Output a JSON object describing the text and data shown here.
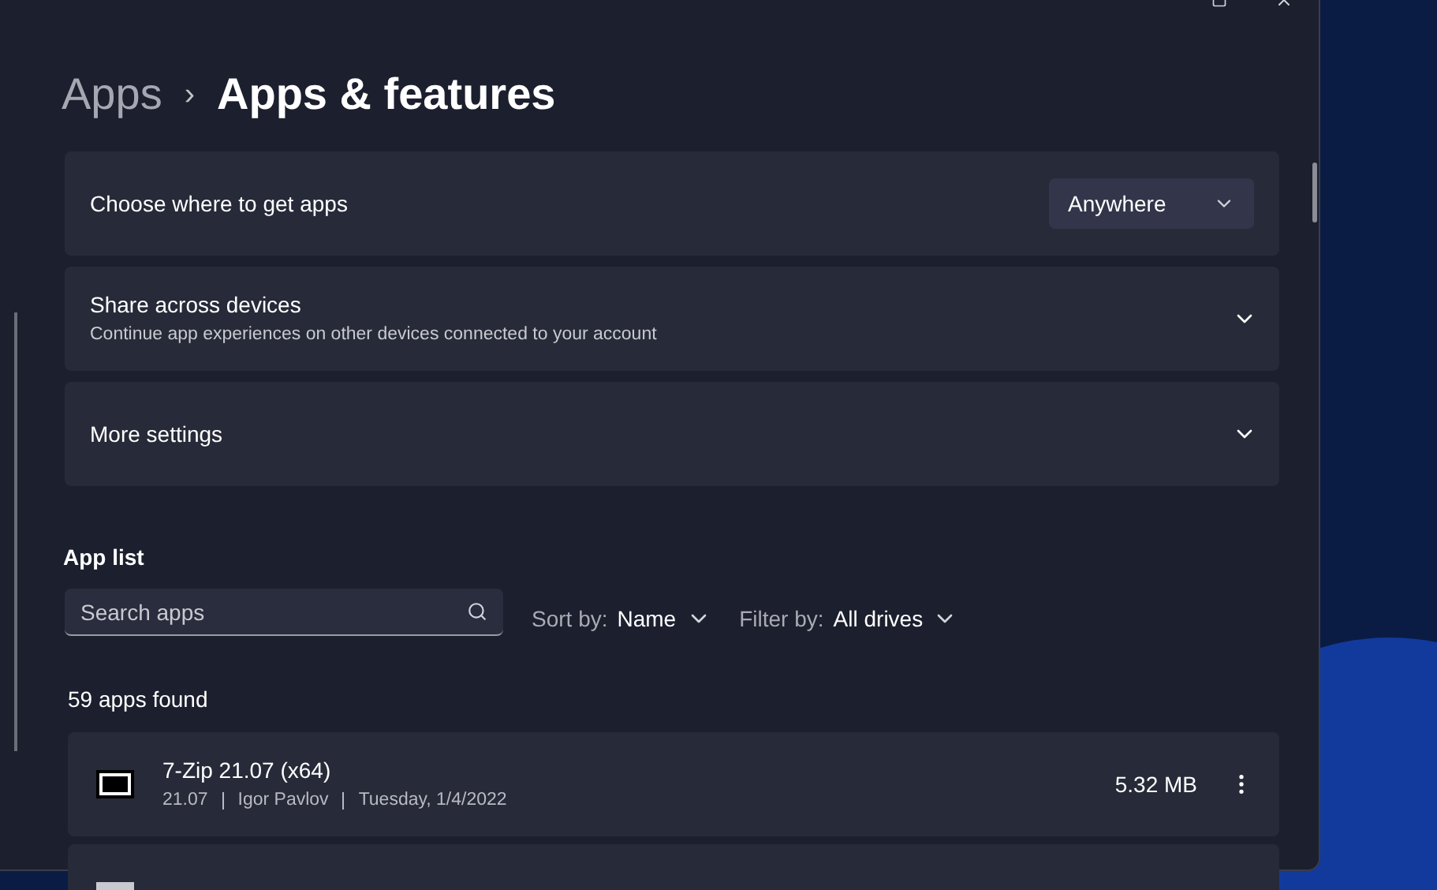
{
  "breadcrumb": {
    "parent": "Apps",
    "separator": "›",
    "current": "Apps & features"
  },
  "settings": [
    {
      "kind": "dropdown",
      "title": "Choose where to get apps",
      "value": "Anywhere"
    },
    {
      "kind": "expander",
      "title": "Share across devices",
      "subtitle": "Continue app experiences on other devices connected to your account",
      "expanded": false
    },
    {
      "kind": "expander",
      "title": "More settings",
      "expanded": false
    }
  ],
  "app_list": {
    "heading": "App list",
    "search": {
      "placeholder": "Search apps"
    },
    "sort": {
      "label": "Sort by:",
      "value": "Name"
    },
    "filter": {
      "label": "Filter by:",
      "value": "All drives"
    },
    "count": "59 apps found",
    "apps": [
      {
        "name": "7-Zip 21.07 (x64)",
        "version": "21.07",
        "publisher": "Igor Pavlov",
        "date": "Tuesday, 1/4/2022",
        "size": "5.32 MB"
      }
    ]
  }
}
